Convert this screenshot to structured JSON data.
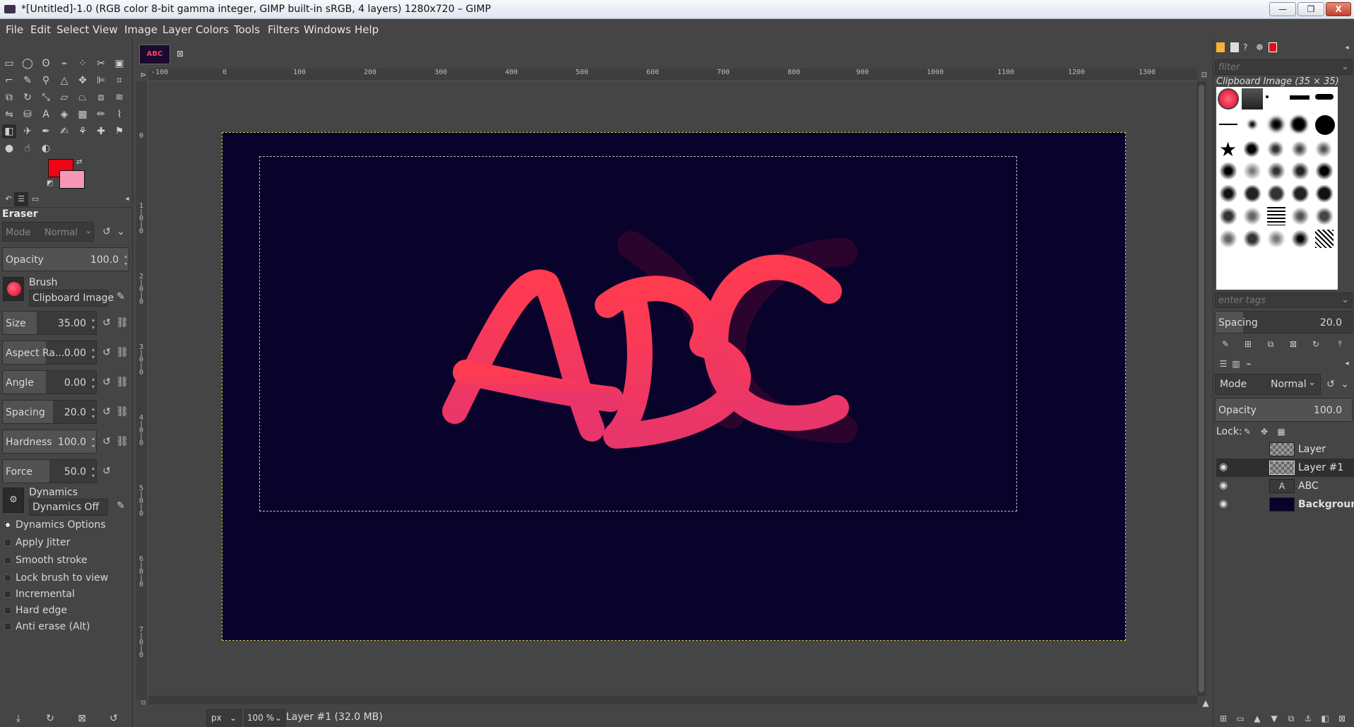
{
  "window": {
    "title": "*[Untitled]-1.0 (RGB color 8-bit gamma integer, GIMP built-in sRGB, 4 layers) 1280x720 – GIMP",
    "minimize": "—",
    "maximize": "❐",
    "close": "X"
  },
  "menu": [
    "File",
    "Edit",
    "Select",
    "View",
    "Image",
    "Layer",
    "Colors",
    "Tools",
    "Filters",
    "Windows",
    "Help"
  ],
  "image_tab": {
    "thumb_text": "ABC"
  },
  "colors": {
    "foreground": "#ec0616",
    "background": "#f697b8",
    "canvas": "#09032b"
  },
  "tool_options": {
    "title": "Eraser",
    "mode_label": "Mode",
    "mode_value": "Normal",
    "opacity": {
      "label": "Opacity",
      "value": "100.0"
    },
    "brush": {
      "label": "Brush",
      "value": "Clipboard Image"
    },
    "size": {
      "label": "Size",
      "value": "35.00"
    },
    "aspect": {
      "label": "Aspect Ra...",
      "value": "0.00"
    },
    "angle": {
      "label": "Angle",
      "value": "0.00"
    },
    "spacing": {
      "label": "Spacing",
      "value": "20.0"
    },
    "hardness": {
      "label": "Hardness",
      "value": "100.0"
    },
    "force": {
      "label": "Force",
      "value": "50.0"
    },
    "dynamics": {
      "label": "Dynamics",
      "value": "Dynamics Off"
    },
    "dynamics_options": "Dynamics Options",
    "checks": [
      "Apply Jitter",
      "Smooth stroke",
      "Lock brush to view",
      "Incremental",
      "Hard edge",
      "Anti erase  (Alt)"
    ]
  },
  "rulers": {
    "h": [
      "-100",
      "0",
      "100",
      "200",
      "300",
      "400",
      "500",
      "600",
      "700",
      "800",
      "900",
      "1000",
      "1100",
      "1200",
      "1300"
    ],
    "v": [
      "0",
      "1|0|0",
      "2|0|0",
      "3|0|0",
      "4|0|0",
      "5|0|0",
      "6|0|0",
      "7|0|0"
    ]
  },
  "status": {
    "unit": "px",
    "zoom": "100 %",
    "message": "Layer #1 (32.0 MB)"
  },
  "brushes": {
    "filter_placeholder": "filter",
    "title": "Clipboard Image (35 × 35)",
    "tags_placeholder": "enter tags",
    "spacing_label": "Spacing",
    "spacing_value": "20.0"
  },
  "layers": {
    "mode_label": "Mode",
    "mode_value": "Normal",
    "opacity_label": "Opacity",
    "opacity_value": "100.0",
    "lock_label": "Lock:",
    "items": [
      "Layer",
      "Layer #1",
      "ABC",
      "Background"
    ]
  }
}
